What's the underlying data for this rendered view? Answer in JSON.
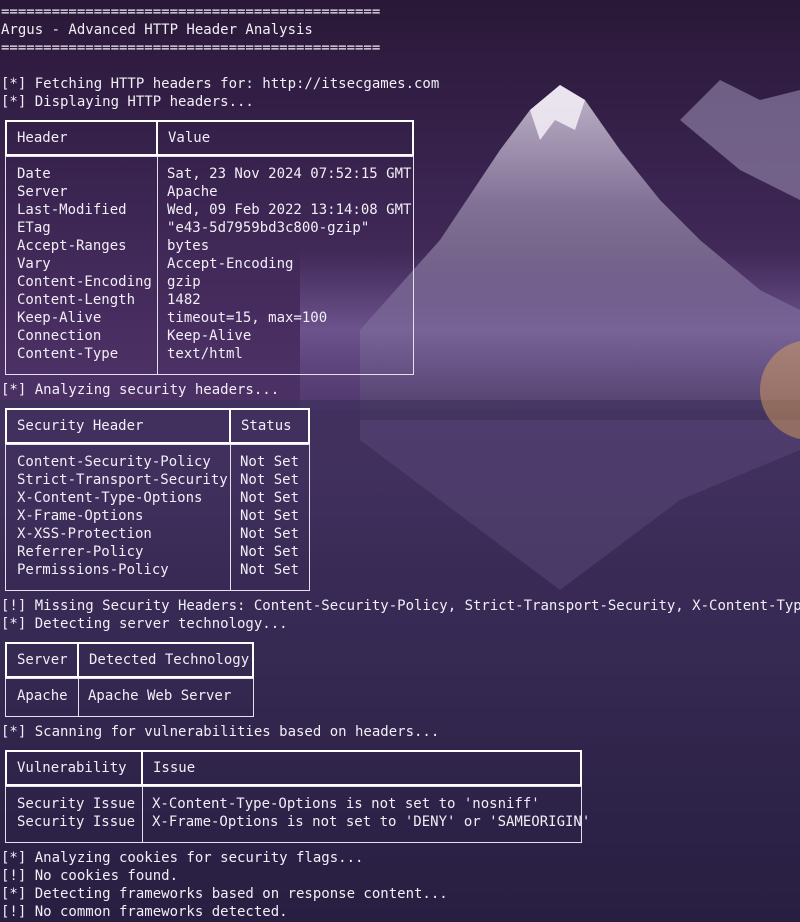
{
  "colors": {
    "terminal_text": "#f2eef6",
    "table_border": "#ffffff"
  },
  "banner": {
    "rule_top": "=============================================",
    "title": "Argus - Advanced HTTP Header Analysis",
    "rule_bottom": "============================================="
  },
  "messages": {
    "fetching": "[*] Fetching HTTP headers for: http://itsecgames.com",
    "displaying": "[*] Displaying HTTP headers...",
    "analyzing_security": "[*] Analyzing security headers...",
    "missing_headers": "[!] Missing Security Headers: Content-Security-Policy, Strict-Transport-Security, X-Content-Type-Opt",
    "detecting_server": "[*] Detecting server technology...",
    "scanning_vulns": "[*] Scanning for vulnerabilities based on headers...",
    "analyzing_cookies": "[*] Analyzing cookies for security flags...",
    "no_cookies": "[!] No cookies found.",
    "detecting_frameworks": "[*] Detecting frameworks based on response content...",
    "no_frameworks": "[!] No common frameworks detected."
  },
  "http_headers_table": {
    "columns": [
      "Header",
      "Value"
    ],
    "rows": [
      [
        "Date",
        "Sat, 23 Nov 2024 07:52:15 GMT"
      ],
      [
        "Server",
        "Apache"
      ],
      [
        "Last-Modified",
        "Wed, 09 Feb 2022 13:14:08 GMT"
      ],
      [
        "ETag",
        "\"e43-5d7959bd3c800-gzip\""
      ],
      [
        "Accept-Ranges",
        "bytes"
      ],
      [
        "Vary",
        "Accept-Encoding"
      ],
      [
        "Content-Encoding",
        "gzip"
      ],
      [
        "Content-Length",
        "1482"
      ],
      [
        "Keep-Alive",
        "timeout=15, max=100"
      ],
      [
        "Connection",
        "Keep-Alive"
      ],
      [
        "Content-Type",
        "text/html"
      ]
    ]
  },
  "security_headers_table": {
    "columns": [
      "Security Header",
      "Status"
    ],
    "rows": [
      [
        "Content-Security-Policy",
        "Not Set"
      ],
      [
        "Strict-Transport-Security",
        "Not Set"
      ],
      [
        "X-Content-Type-Options",
        "Not Set"
      ],
      [
        "X-Frame-Options",
        "Not Set"
      ],
      [
        "X-XSS-Protection",
        "Not Set"
      ],
      [
        "Referrer-Policy",
        "Not Set"
      ],
      [
        "Permissions-Policy",
        "Not Set"
      ]
    ]
  },
  "server_table": {
    "columns": [
      "Server",
      "Detected Technology"
    ],
    "rows": [
      [
        "Apache",
        "Apache Web Server"
      ]
    ]
  },
  "vulnerability_table": {
    "columns": [
      "Vulnerability",
      "Issue"
    ],
    "rows": [
      [
        "Security Issue",
        "X-Content-Type-Options is not set to 'nosniff'"
      ],
      [
        "Security Issue",
        "X-Frame-Options is not set to 'DENY' or 'SAMEORIGIN'"
      ]
    ]
  }
}
